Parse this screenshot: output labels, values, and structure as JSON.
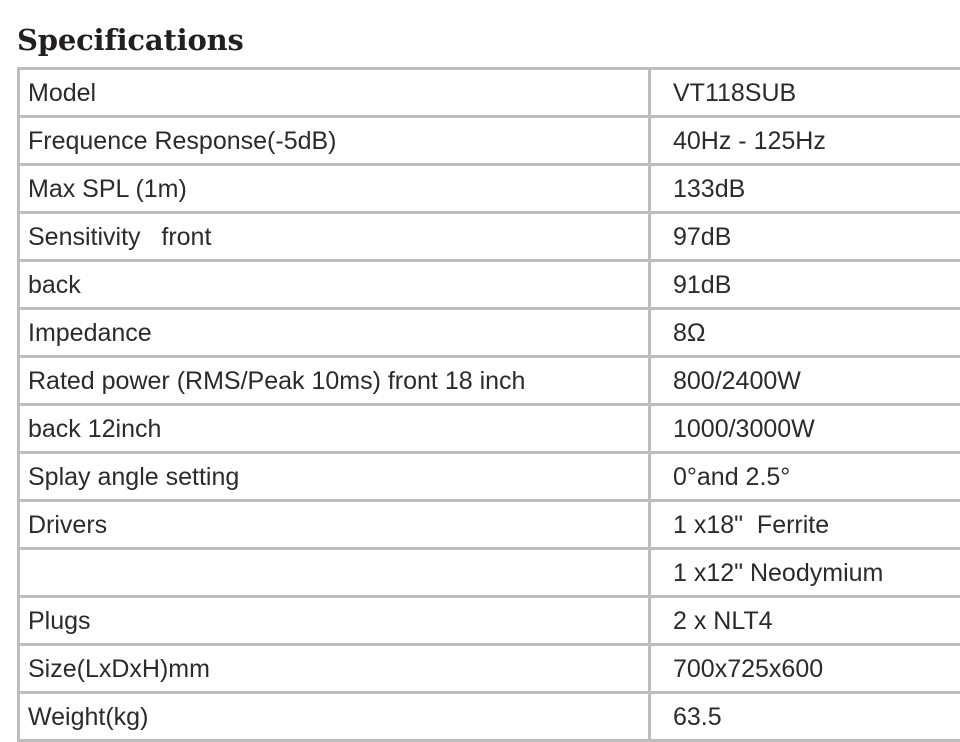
{
  "page": {
    "title": "Specifications"
  },
  "table": {
    "border_color": "#bdbdbd",
    "text_color": "#2b2b2b",
    "rows": [
      {
        "label": "Model",
        "value": "VT118SUB"
      },
      {
        "label": "Frequence Response(-5dB)",
        "value": "40Hz - 125Hz"
      },
      {
        "label": "Max SPL (1m)",
        "value": "133dB"
      },
      {
        "label": "Sensitivity   front",
        "value": "97dB"
      },
      {
        "label": "back",
        "value": "91dB"
      },
      {
        "label": "Impedance",
        "value": "8Ω"
      },
      {
        "label": "Rated power (RMS/Peak 10ms) front 18 inch",
        "value": "800/2400W"
      },
      {
        "label": "back 12inch",
        "value": "1000/3000W"
      },
      {
        "label": "Splay angle setting",
        "value": "0°and 2.5°"
      },
      {
        "label": "Drivers",
        "value": "1 x18\"  Ferrite"
      },
      {
        "label": "",
        "value": "1 x12\" Neodymium"
      },
      {
        "label": "Plugs",
        "value": "2 x NLT4"
      },
      {
        "label": "Size(LxDxH)mm",
        "value": "700x725x600"
      },
      {
        "label": "Weight(kg)",
        "value": "63.5"
      }
    ]
  }
}
